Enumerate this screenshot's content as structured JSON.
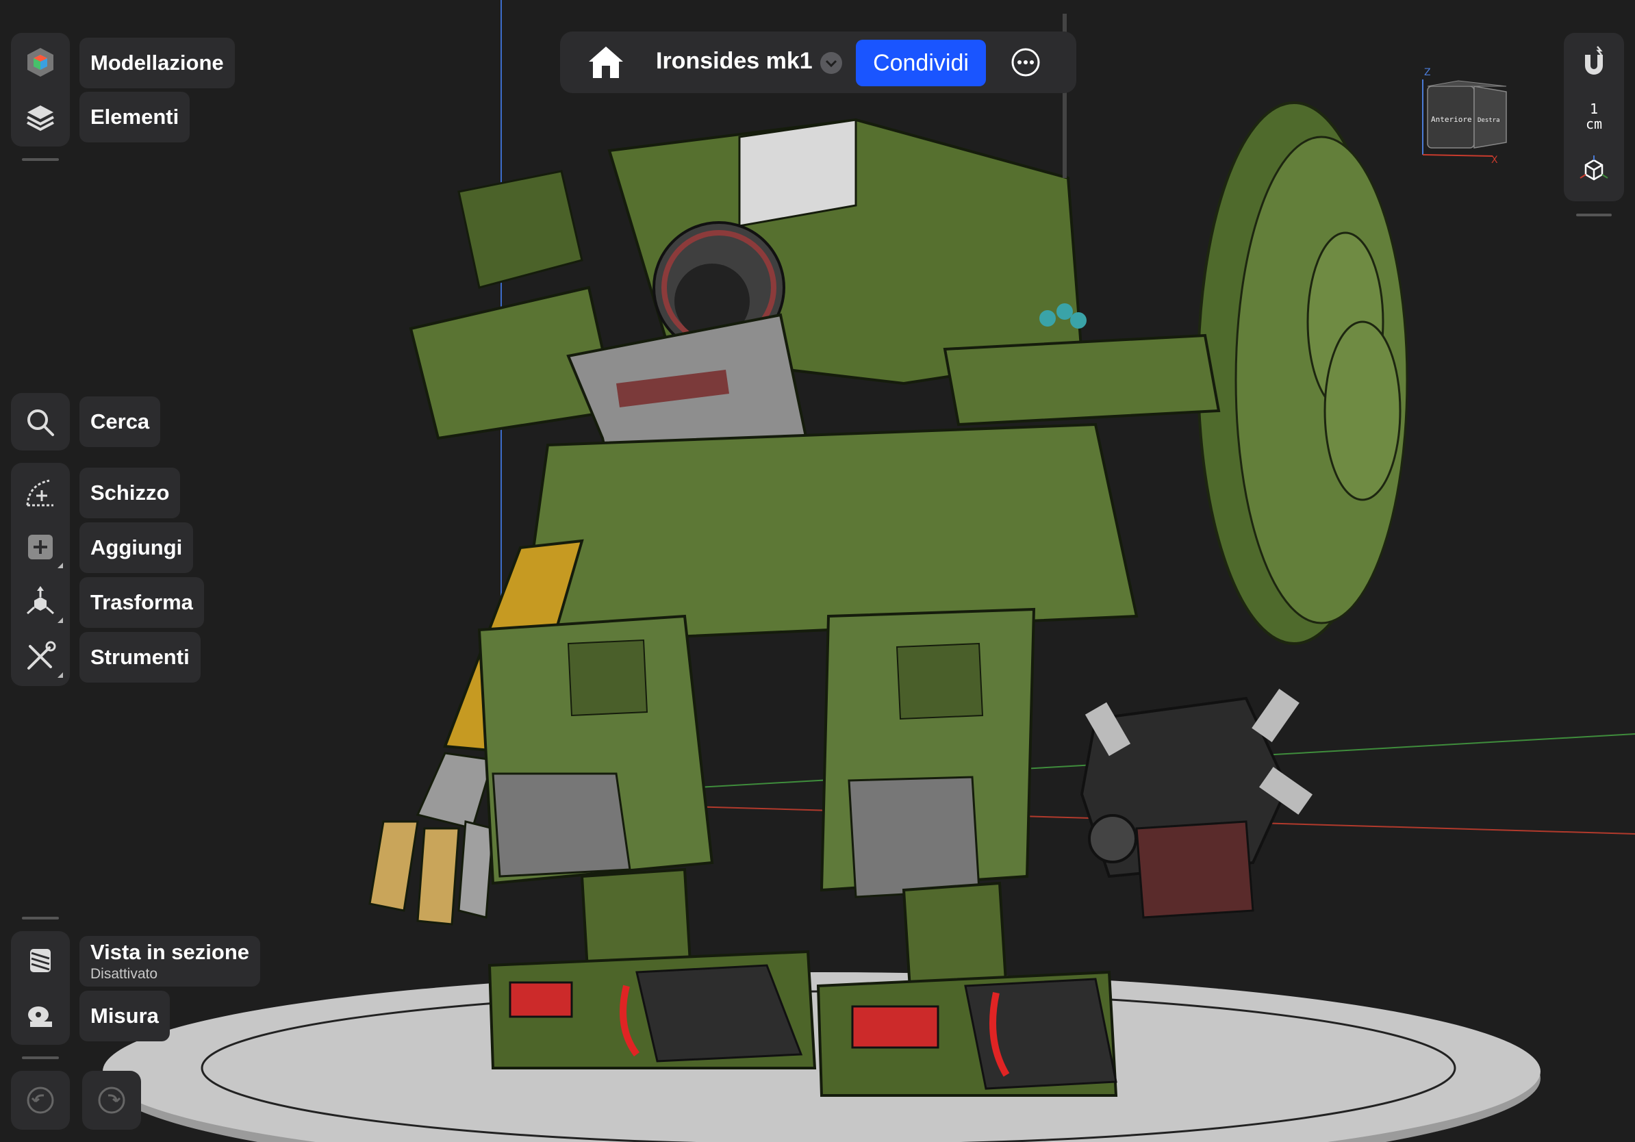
{
  "app": {
    "document_title": "Ironsides mk1",
    "share_label": "Condividi"
  },
  "left_toolbar": {
    "workspace": {
      "label": "Modellazione",
      "icon": "workspace-cube-icon"
    },
    "elements": {
      "label": "Elementi",
      "icon": "layers-icon"
    },
    "search": {
      "label": "Cerca",
      "icon": "search-icon"
    },
    "sketch": {
      "label": "Schizzo",
      "icon": "sketch-icon"
    },
    "add": {
      "label": "Aggiungi",
      "icon": "plus-icon"
    },
    "transform": {
      "label": "Trasforma",
      "icon": "transform-icon"
    },
    "tools": {
      "label": "Strumenti",
      "icon": "tools-icon"
    },
    "section_view": {
      "label": "Vista in sezione",
      "status": "Disattivato",
      "icon": "section-view-icon"
    },
    "measure": {
      "label": "Misura",
      "icon": "tape-measure-icon"
    },
    "undo": {
      "icon": "undo-icon"
    },
    "redo": {
      "icon": "redo-icon"
    }
  },
  "right_toolbar": {
    "snap": {
      "icon": "magnet-icon"
    },
    "grid_scale": {
      "value": "1",
      "unit": "cm"
    },
    "view": {
      "icon": "view-cube-icon"
    }
  },
  "nav_cube": {
    "front_label": "Anteriore",
    "right_label": "Destra",
    "axis_z": "Z",
    "axis_x": "X"
  },
  "colors": {
    "accent": "#1a55ff",
    "panel": "#2c2c2e",
    "background": "#1e1e1e",
    "model_green": "#5f7a3a"
  }
}
